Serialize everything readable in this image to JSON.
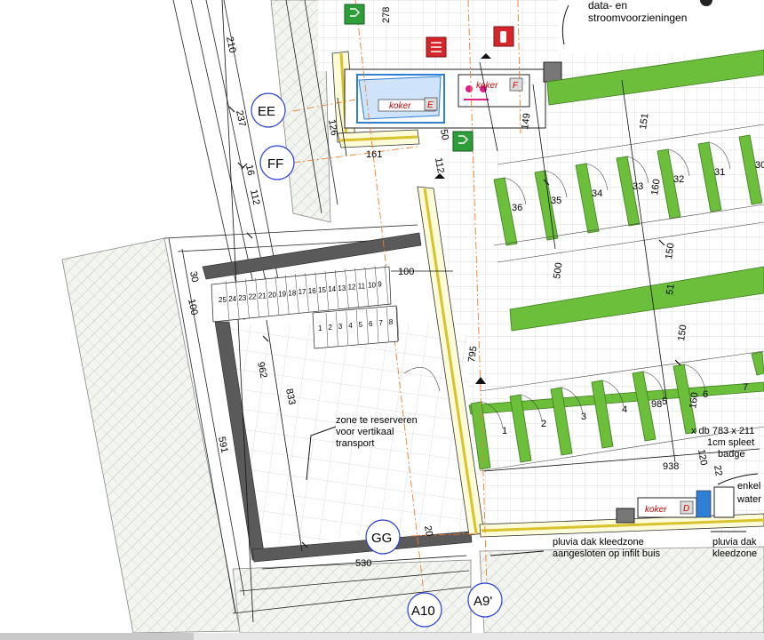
{
  "grid_labels": {
    "ee": "EE",
    "ff": "FF",
    "gg": "GG",
    "a10": "A10",
    "a9p": "A9'"
  },
  "dimensions": {
    "d210": "210",
    "d278": "278",
    "d237": "237",
    "d126": "126",
    "d161": "161",
    "d50": "50",
    "d112a": "112",
    "d112b": "112",
    "d16": "16",
    "d149": "149",
    "d151": "151",
    "d160a": "160",
    "d160b": "160",
    "d150a": "150",
    "d150b": "150",
    "d500": "500",
    "d51": "51",
    "d795": "795",
    "d100a": "100",
    "d100b": "100",
    "d30": "30",
    "d962": "962",
    "d833": "833",
    "d591": "591",
    "d530": "530",
    "d20": "20",
    "d938": "938",
    "d120": "120",
    "d22": "22",
    "d98": "98"
  },
  "stair_upper": [
    "25",
    "24",
    "23",
    "22",
    "21",
    "20",
    "19",
    "18",
    "17",
    "16",
    "15",
    "14",
    "13",
    "12",
    "11",
    "10",
    "9"
  ],
  "stair_lower": [
    "1",
    "2",
    "3",
    "4",
    "5",
    "6",
    "7",
    "8"
  ],
  "parking_top": [
    "36",
    "35",
    "34",
    "33",
    "32",
    "31",
    "30"
  ],
  "parking_bottom": [
    "1",
    "2",
    "3",
    "4",
    "5",
    "6",
    "7"
  ],
  "notes": {
    "data1": "data- en",
    "data2": "stroomvoorzieningen",
    "zone1": "zone te reserveren",
    "zone2": "voor vertikaal",
    "zone3": "transport",
    "db1": "x db 783 x 211",
    "db2": "1cm spleet",
    "db3": "badge",
    "pluv1": "pluvia dak kleedzone",
    "pluv2": "aangesloten op infilt buis",
    "pluv3": "pluvia dak",
    "pluv4": "kleedzone",
    "enk1": "enkel",
    "enk2": "water"
  },
  "shafts": {
    "koker": "koker",
    "e": "E",
    "f": "F",
    "d": "D"
  },
  "colors": {
    "green_stall": "#6cbf3a",
    "wall_dark": "#555555",
    "wall_yellow": "#e9d33a",
    "dim_line": "#000000",
    "orange_axis": "#ef7d2d",
    "grid_circle": "#2a3fd6",
    "sign_green": "#2e9e3a",
    "sign_red": "#d7262b"
  }
}
